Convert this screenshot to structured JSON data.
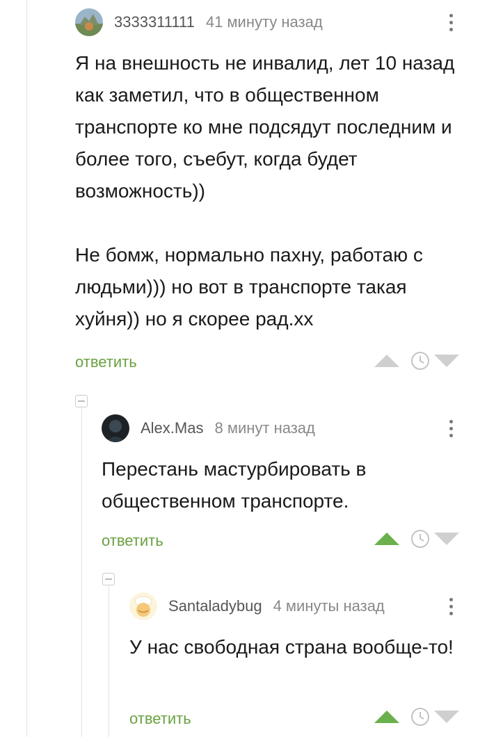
{
  "comments": [
    {
      "username": "3333311111",
      "time": "41 минуту назад",
      "paragraphs": [
        "Я на внешность не инвалид, лет 10 назад как заметил, что в общественном транспорте ко мне подсядут последним и более того, съебут, когда будет возможность))",
        "Не бомж, нормально пахну, работаю с людьми))) но вот в транспорте такая хуйня)) но я скорее рад.хх"
      ],
      "reply_label": "ответить"
    },
    {
      "username": "Alex.Mas",
      "time": "8 минут назад",
      "paragraphs": [
        "Перестань мастурбировать в общественном транспорте."
      ],
      "reply_label": "ответить"
    },
    {
      "username": "Santaladybug",
      "time": "4 минуты назад",
      "paragraphs": [
        "У нас свободная страна вообще-то!"
      ],
      "reply_label": "ответить"
    }
  ],
  "colors": {
    "accent_green": "#6aa041",
    "upvote_active": "#6ab04c",
    "vote_inactive": "#cfcfcf"
  }
}
